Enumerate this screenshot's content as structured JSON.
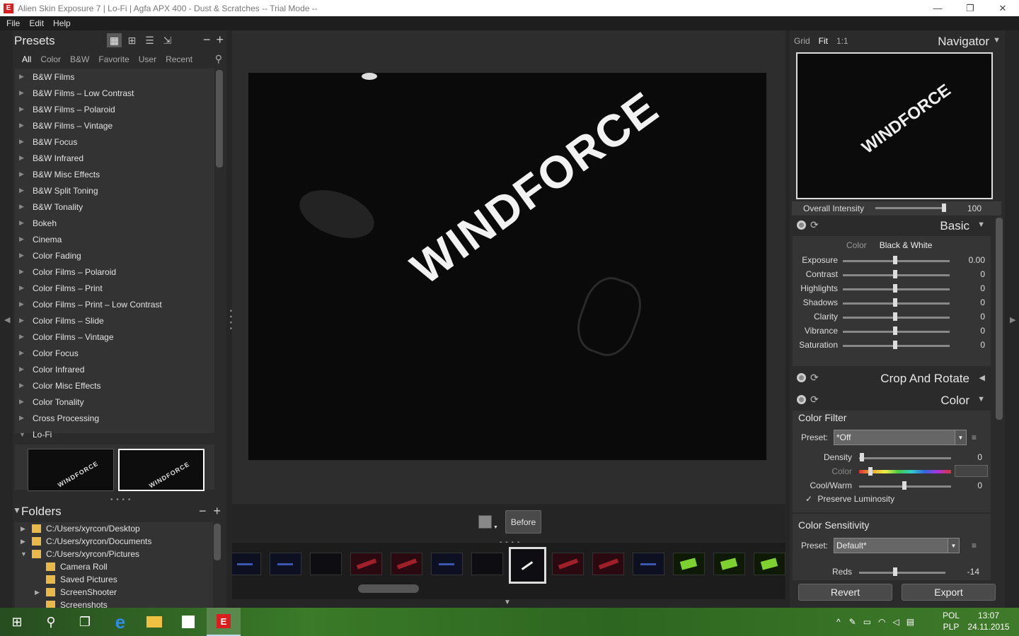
{
  "window": {
    "title": "Alien Skin Exposure 7 | Lo-Fi | Agfa APX 400 - Dust & Scratches -- Trial Mode --",
    "app_icon": "E",
    "controls": [
      "—",
      "❐",
      "✕"
    ]
  },
  "menu": [
    "File",
    "Edit",
    "Help"
  ],
  "presets": {
    "title": "Presets",
    "filters": [
      "All",
      "Color",
      "B&W",
      "Favorite",
      "User",
      "Recent"
    ],
    "selected_filter": "All",
    "items": [
      {
        "label": "B&W Films",
        "expanded": false
      },
      {
        "label": "B&W Films – Low Contrast",
        "expanded": false
      },
      {
        "label": "B&W Films – Polaroid",
        "expanded": false
      },
      {
        "label": "B&W Films – Vintage",
        "expanded": false
      },
      {
        "label": "B&W Focus",
        "expanded": false
      },
      {
        "label": "B&W Infrared",
        "expanded": false
      },
      {
        "label": "B&W Misc Effects",
        "expanded": false
      },
      {
        "label": "B&W Split Toning",
        "expanded": false
      },
      {
        "label": "B&W Tonality",
        "expanded": false
      },
      {
        "label": "Bokeh",
        "expanded": false
      },
      {
        "label": "Cinema",
        "expanded": false
      },
      {
        "label": "Color Fading",
        "expanded": false
      },
      {
        "label": "Color Films – Polaroid",
        "expanded": false
      },
      {
        "label": "Color Films – Print",
        "expanded": false
      },
      {
        "label": "Color Films – Print – Low Contrast",
        "expanded": false
      },
      {
        "label": "Color Films – Slide",
        "expanded": false
      },
      {
        "label": "Color Films – Vintage",
        "expanded": false
      },
      {
        "label": "Color Focus",
        "expanded": false
      },
      {
        "label": "Color Infrared",
        "expanded": false
      },
      {
        "label": "Color Misc Effects",
        "expanded": false
      },
      {
        "label": "Color Tonality",
        "expanded": false
      },
      {
        "label": "Cross Processing",
        "expanded": false
      },
      {
        "label": "Lo-Fi",
        "expanded": true
      }
    ],
    "thumb_label": "WINDFORCE"
  },
  "folders": {
    "title": "Folders",
    "items": [
      {
        "label": "C:/Users/xyrcon/Desktop",
        "expand": "▶",
        "indent": 0
      },
      {
        "label": "C:/Users/xyrcon/Documents",
        "expand": "▶",
        "indent": 0
      },
      {
        "label": "C:/Users/xyrcon/Pictures",
        "expand": "▼",
        "indent": 0
      },
      {
        "label": "Camera Roll",
        "expand": "",
        "indent": 1
      },
      {
        "label": "Saved Pictures",
        "expand": "",
        "indent": 1
      },
      {
        "label": "ScreenShooter",
        "expand": "▶",
        "indent": 1
      },
      {
        "label": "Screenshots",
        "expand": "",
        "indent": 1
      }
    ]
  },
  "preview": {
    "image_text": "WINDFORCE",
    "before_label": "Before"
  },
  "filmstrip": {
    "thumbs": [
      "blue",
      "blue",
      "dark",
      "red",
      "red",
      "blue",
      "dark",
      "sel",
      "red",
      "red",
      "blue",
      "green",
      "green",
      "green",
      "blue"
    ]
  },
  "navigator": {
    "modes": [
      "Grid",
      "Fit",
      "1:1"
    ],
    "selected_mode": "Fit",
    "title": "Navigator",
    "image_text": "WINDFORCE",
    "intensity_label": "Overall Intensity",
    "intensity_value": "100",
    "intensity_fraction": 1.0
  },
  "basic": {
    "title": "Basic",
    "tabs": [
      "Color",
      "Black & White"
    ],
    "selected_tab": "Black & White",
    "sliders": [
      {
        "label": "Exposure",
        "value": "0.00"
      },
      {
        "label": "Contrast",
        "value": "0"
      },
      {
        "label": "Highlights",
        "value": "0"
      },
      {
        "label": "Shadows",
        "value": "0"
      },
      {
        "label": "Clarity",
        "value": "0"
      },
      {
        "label": "Vibrance",
        "value": "0"
      },
      {
        "label": "Saturation",
        "value": "0"
      }
    ]
  },
  "crop": {
    "title": "Crop And Rotate"
  },
  "color": {
    "title": "Color",
    "filter": {
      "title": "Color Filter",
      "preset_label": "Preset:",
      "preset_value": "*Off",
      "density_label": "Density",
      "density_value": "0",
      "color_label": "Color",
      "coolwarm_label": "Cool/Warm",
      "coolwarm_value": "0",
      "preserve_label": "Preserve Luminosity",
      "preserve_checked": "✓"
    },
    "sensitivity": {
      "title": "Color Sensitivity",
      "preset_label": "Preset:",
      "preset_value": "Default*",
      "reds_label": "Reds",
      "reds_value": "-14"
    }
  },
  "actions": {
    "revert": "Revert",
    "export": "Export"
  },
  "taskbar": {
    "lang_top": "POL",
    "lang_bottom": "PLP",
    "time": "13:07",
    "date": "24.11.2015"
  },
  "colors": {
    "panel_bg": "#2b2b2b",
    "list_bg": "#333333",
    "accent_red": "#d81e1e",
    "taskbar_green": "#3a7a28"
  }
}
